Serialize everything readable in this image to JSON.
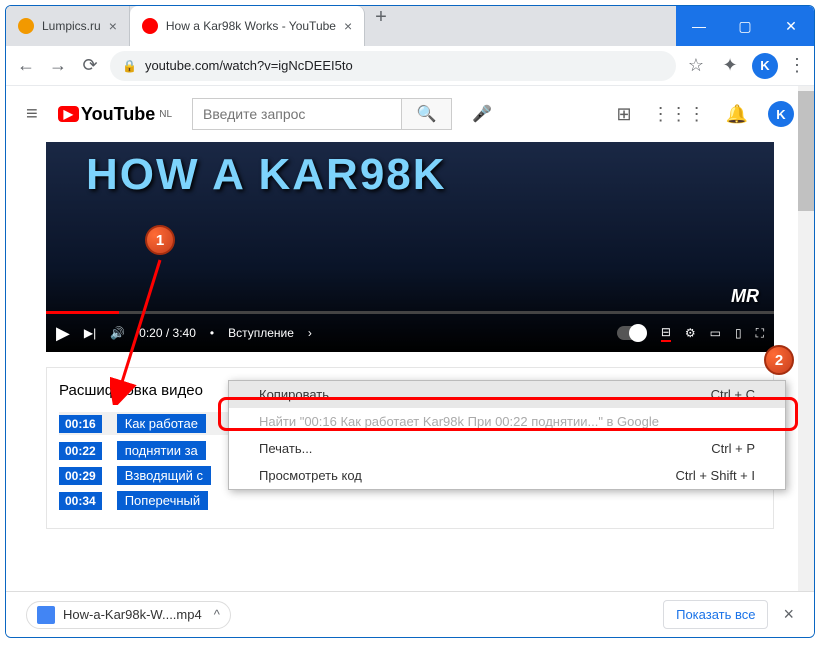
{
  "window": {
    "tabs": [
      {
        "title": "Lumpics.ru",
        "active": false
      },
      {
        "title": "How a Kar98k Works - YouTube",
        "active": true
      }
    ],
    "controls": {
      "min": "—",
      "max": "▢",
      "close": "✕"
    }
  },
  "address": {
    "url": "youtube.com/watch?v=igNcDEEI5to",
    "back": "←",
    "forward": "→",
    "reload": "⟳",
    "star": "☆",
    "puzzle": "✦",
    "avatar": "K",
    "dots": "⋮"
  },
  "youtube": {
    "logo_text": "YouTube",
    "logo_sup": "NL",
    "search_placeholder": "Введите запрос",
    "icons": {
      "mic": "🎤",
      "create": "⊞",
      "apps": "⋮⋮⋮",
      "bell": "🔔",
      "avatar": "K"
    }
  },
  "player": {
    "title_overlay": "HOW A KAR98K",
    "corner_logo": "MR",
    "time": "0:20 / 3:40",
    "chapter": "Вступление",
    "play": "▶",
    "next": "▶|",
    "vol": "🔊",
    "cc": "⊟",
    "gear": "⚙",
    "mini": "▭",
    "theater": "▯",
    "full": "⛶"
  },
  "transcript": {
    "title": "Расшифровка видео",
    "dots": "⋮",
    "close": "✕",
    "rows": [
      {
        "time": "00:16",
        "text": "Как работае"
      },
      {
        "time": "00:22",
        "text": "поднятии за"
      },
      {
        "time": "00:29",
        "text": "Взводящий с"
      },
      {
        "time": "00:34",
        "text": "Поперечный"
      }
    ]
  },
  "context_menu": {
    "items": [
      {
        "label": "Копировать",
        "shortcut": "Ctrl + C",
        "hl": true
      },
      {
        "label": "Найти \"00:16 Как работает Kar98k При 00:22 поднятии...\" в Google",
        "shortcut": "",
        "disabled": true
      },
      {
        "label": "Печать...",
        "shortcut": "Ctrl + P"
      },
      {
        "label": "Просмотреть код",
        "shortcut": "Ctrl + Shift + I"
      }
    ]
  },
  "badges": {
    "one": "1",
    "two": "2"
  },
  "download": {
    "filename": "How-a-Kar98k-W....mp4",
    "show_all": "Показать все"
  }
}
